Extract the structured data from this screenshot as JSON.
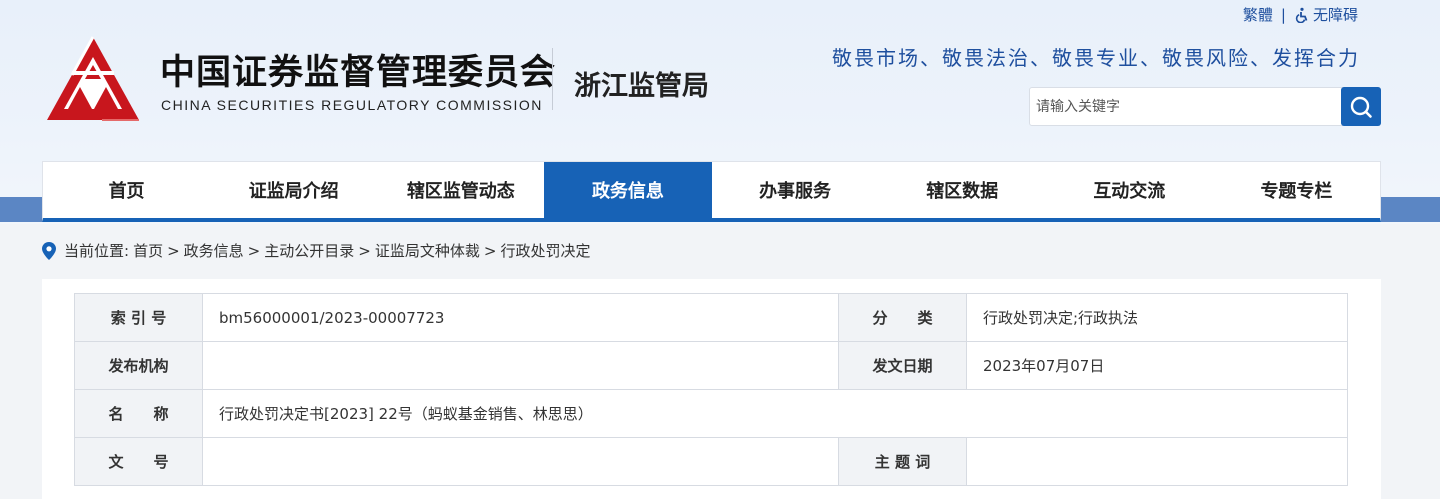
{
  "top_links": {
    "traditional": "繁體",
    "separator": "|",
    "accessibility": "无障碍"
  },
  "org": {
    "name_cn": "中国证券监督管理委员会",
    "name_en": "CHINA SECURITIES REGULATORY COMMISSION",
    "bureau": "浙江监管局"
  },
  "slogan": "敬畏市场、敬畏法治、敬畏专业、敬畏风险、发挥合力",
  "search": {
    "placeholder": "请输入关键字",
    "value": ""
  },
  "nav": {
    "items": [
      {
        "label": "首页",
        "active": false
      },
      {
        "label": "证监局介绍",
        "active": false
      },
      {
        "label": "辖区监管动态",
        "active": false
      },
      {
        "label": "政务信息",
        "active": true
      },
      {
        "label": "办事服务",
        "active": false
      },
      {
        "label": "辖区数据",
        "active": false
      },
      {
        "label": "互动交流",
        "active": false
      },
      {
        "label": "专题专栏",
        "active": false
      }
    ]
  },
  "breadcrumb": {
    "prefix": "当前位置:",
    "items": [
      "首页",
      "政务信息",
      "主动公开目录",
      "证监局文种体裁",
      "行政处罚决定"
    ],
    "separator": ">"
  },
  "info": {
    "index_label": "索 引 号",
    "index_value": "bm56000001/2023-00007723",
    "category_label": "分　　类",
    "category_value": "行政处罚决定;行政执法",
    "publisher_label": "发布机构",
    "publisher_value": "",
    "date_label": "发文日期",
    "date_value": "2023年07月07日",
    "title_label": "名　　称",
    "title_value": "行政处罚决定书[2023] 22号（蚂蚁基金销售、林思思）",
    "docno_label": "文　　号",
    "docno_value": "",
    "keywords_label": "主 题 词",
    "keywords_value": ""
  },
  "colors": {
    "primary": "#1762b6",
    "band": "#5b86c4",
    "logo_red": "#c8161d"
  }
}
